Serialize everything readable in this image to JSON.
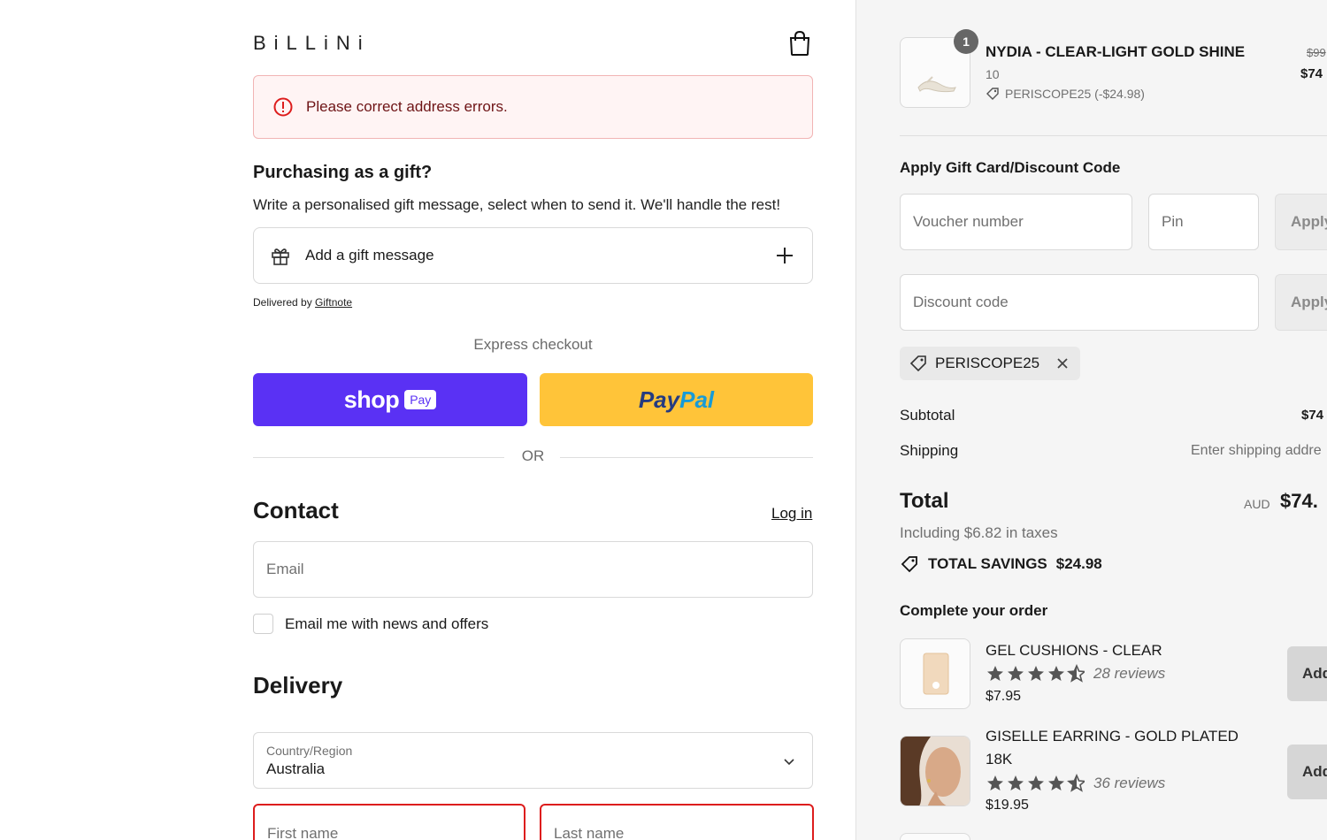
{
  "header": {
    "logo": "BiLLiNi"
  },
  "error": {
    "message": "Please correct address errors."
  },
  "gift": {
    "title": "Purchasing as a gift?",
    "description": "Write a personalised gift message, select when to send it. We'll handle the rest!",
    "add_label": "Add a gift message",
    "delivered_prefix": "Delivered by",
    "delivered_link": "Giftnote"
  },
  "express": {
    "title": "Express checkout",
    "shop_word": "shop",
    "shop_pay": "Pay",
    "paypal_a": "Pay",
    "paypal_b": "Pal",
    "or": "OR"
  },
  "contact": {
    "heading": "Contact",
    "login": "Log in",
    "email_placeholder": "Email",
    "news_label": "Email me with news and offers"
  },
  "delivery": {
    "heading": "Delivery",
    "country_label": "Country/Region",
    "country_value": "Australia",
    "first_name": "First name",
    "last_name": "Last name"
  },
  "cart_item": {
    "quantity": "1",
    "name": "NYDIA - CLEAR-LIGHT GOLD SHINE",
    "size": "10",
    "discount": "PERISCOPE25 (-$24.98)",
    "old_price": "$99",
    "new_price": "$74"
  },
  "discounts": {
    "title": "Apply Gift Card/Discount Code",
    "voucher_placeholder": "Voucher number",
    "pin_placeholder": "Pin",
    "apply_label": "Apply",
    "discount_placeholder": "Discount code",
    "applied_code": "PERISCOPE25"
  },
  "summary": {
    "subtotal_label": "Subtotal",
    "subtotal_value": "$74",
    "shipping_label": "Shipping",
    "shipping_value": "Enter shipping addre",
    "total_label": "Total",
    "currency": "AUD",
    "total_value": "$74.",
    "taxes": "Including $6.82 in taxes",
    "savings_label": "TOTAL SAVINGS",
    "savings_value": "$24.98"
  },
  "upsell": {
    "title": "Complete your order",
    "add_label": "Add",
    "items": [
      {
        "name": "GEL CUSHIONS - CLEAR",
        "reviews": "28 reviews",
        "price": "$7.95",
        "rating": 4.5
      },
      {
        "name_line1": "GISELLE EARRING - GOLD PLATED",
        "name_line2": "18K",
        "reviews": "36 reviews",
        "price": "$19.95",
        "rating": 4.5
      }
    ]
  },
  "colors": {
    "shop_pay": "#5a31f4",
    "paypal": "#ffc439",
    "error": "#dd1d1d",
    "aside_bg": "#f5f5f5"
  }
}
